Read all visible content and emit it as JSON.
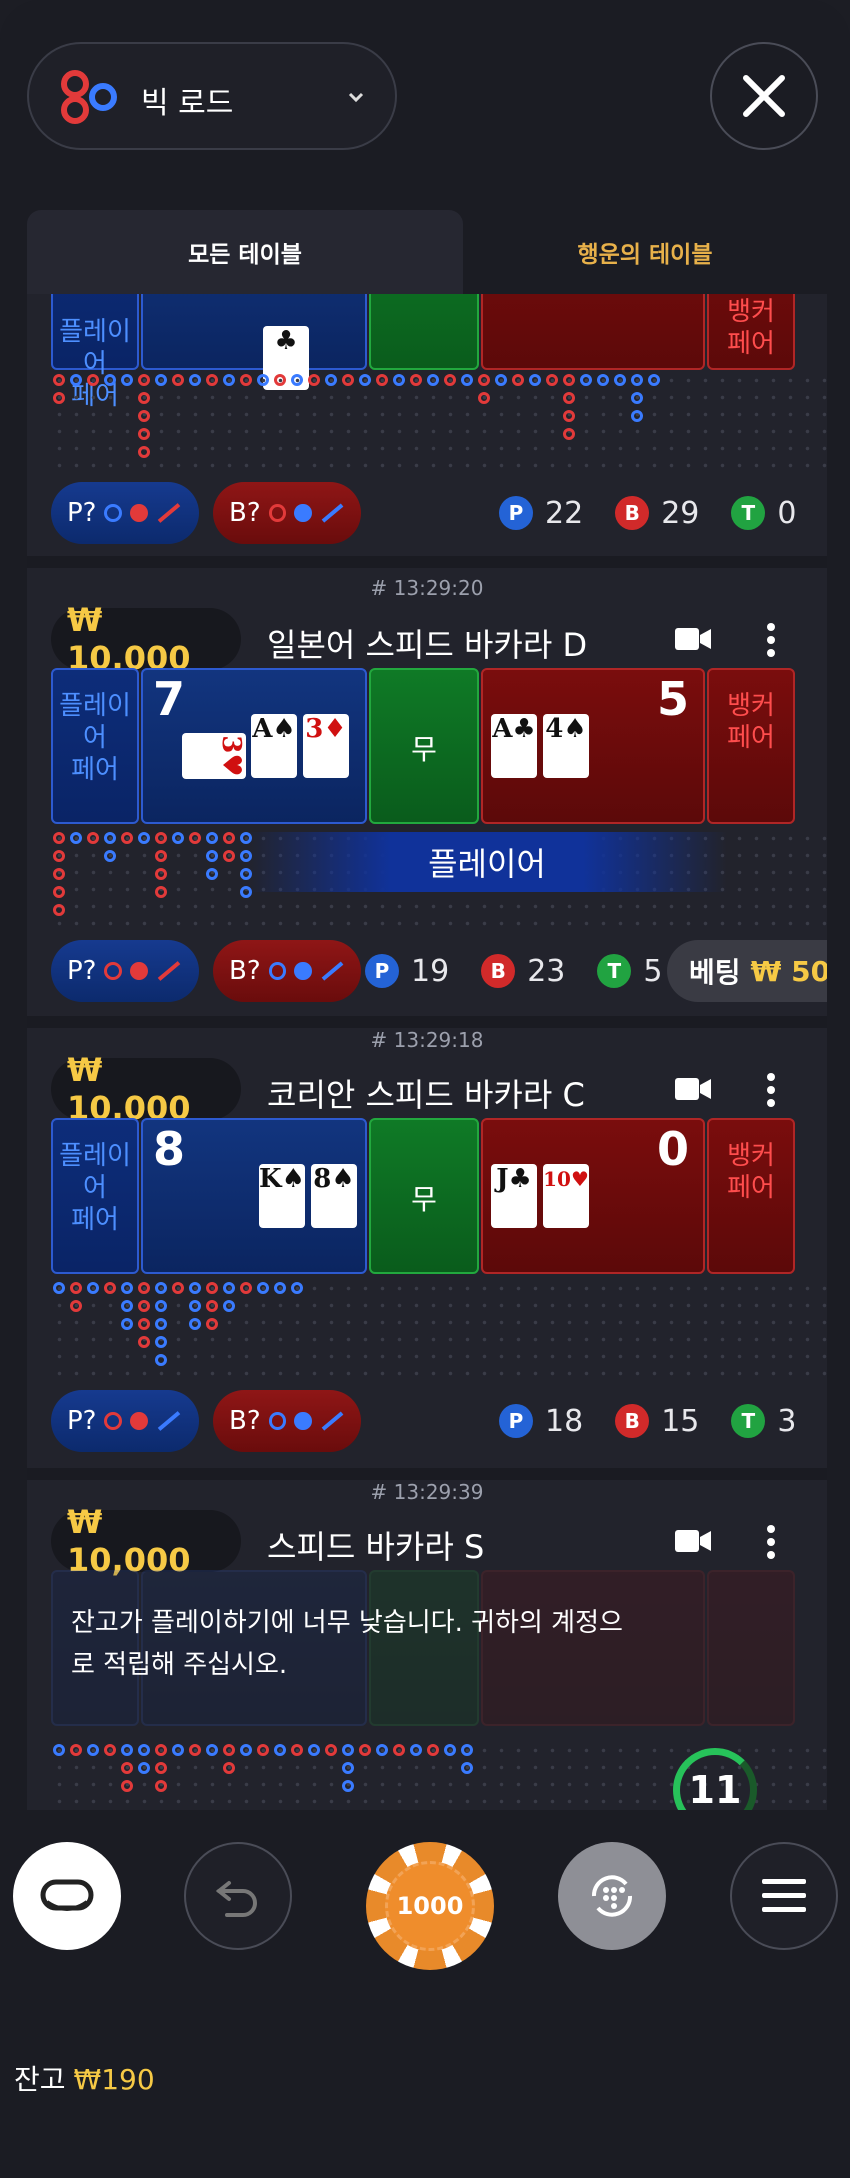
{
  "header": {
    "road_label": "빅 로드"
  },
  "tabs": {
    "all": "모든 테이블",
    "lucky": "행운의 테이블"
  },
  "common": {
    "player_pair": "플레이어\n페어",
    "banker_pair": "뱅커\n페어",
    "tie": "무",
    "pred_p": "P?",
    "pred_b": "B?"
  },
  "tables": [
    {
      "stats": {
        "p": "22",
        "b": "29",
        "t": "0"
      }
    },
    {
      "time": "# 13:29:20",
      "min_bet": "₩ 10,000",
      "name": "일본어 스피드 바카라 D",
      "player_score": "7",
      "banker_score": "5",
      "player_cards": [
        "3♥",
        "A♠",
        "3♦"
      ],
      "banker_cards": [
        "A♣",
        "4♠"
      ],
      "result": "플레이어",
      "stats": {
        "p": "19",
        "b": "23",
        "t": "5"
      },
      "bet_label": "베팅",
      "bet_amount": "₩ 50,"
    },
    {
      "time": "# 13:29:18",
      "min_bet": "₩ 10,000",
      "name": "코리안 스피드 바카라 C",
      "player_score": "8",
      "banker_score": "0",
      "player_cards": [
        "K♠",
        "8♠"
      ],
      "banker_cards": [
        "J♣",
        "10♥"
      ],
      "stats": {
        "p": "18",
        "b": "15",
        "t": "3"
      }
    },
    {
      "time": "# 13:29:39",
      "min_bet": "₩ 10,000",
      "name": "스피드 바카라 S",
      "message": "잔고가 플레이하기에 너무 낮습니다. 귀하의 계정으로 적립해 주십시오.",
      "timer": "11"
    }
  ],
  "bottom": {
    "chip_value": "1000",
    "balance_label": "잔고",
    "balance_amount": "₩190"
  },
  "colors": {
    "gold": "#f6c945",
    "player": "#2463d6",
    "banker": "#d12a2a",
    "tie": "#21a341"
  }
}
